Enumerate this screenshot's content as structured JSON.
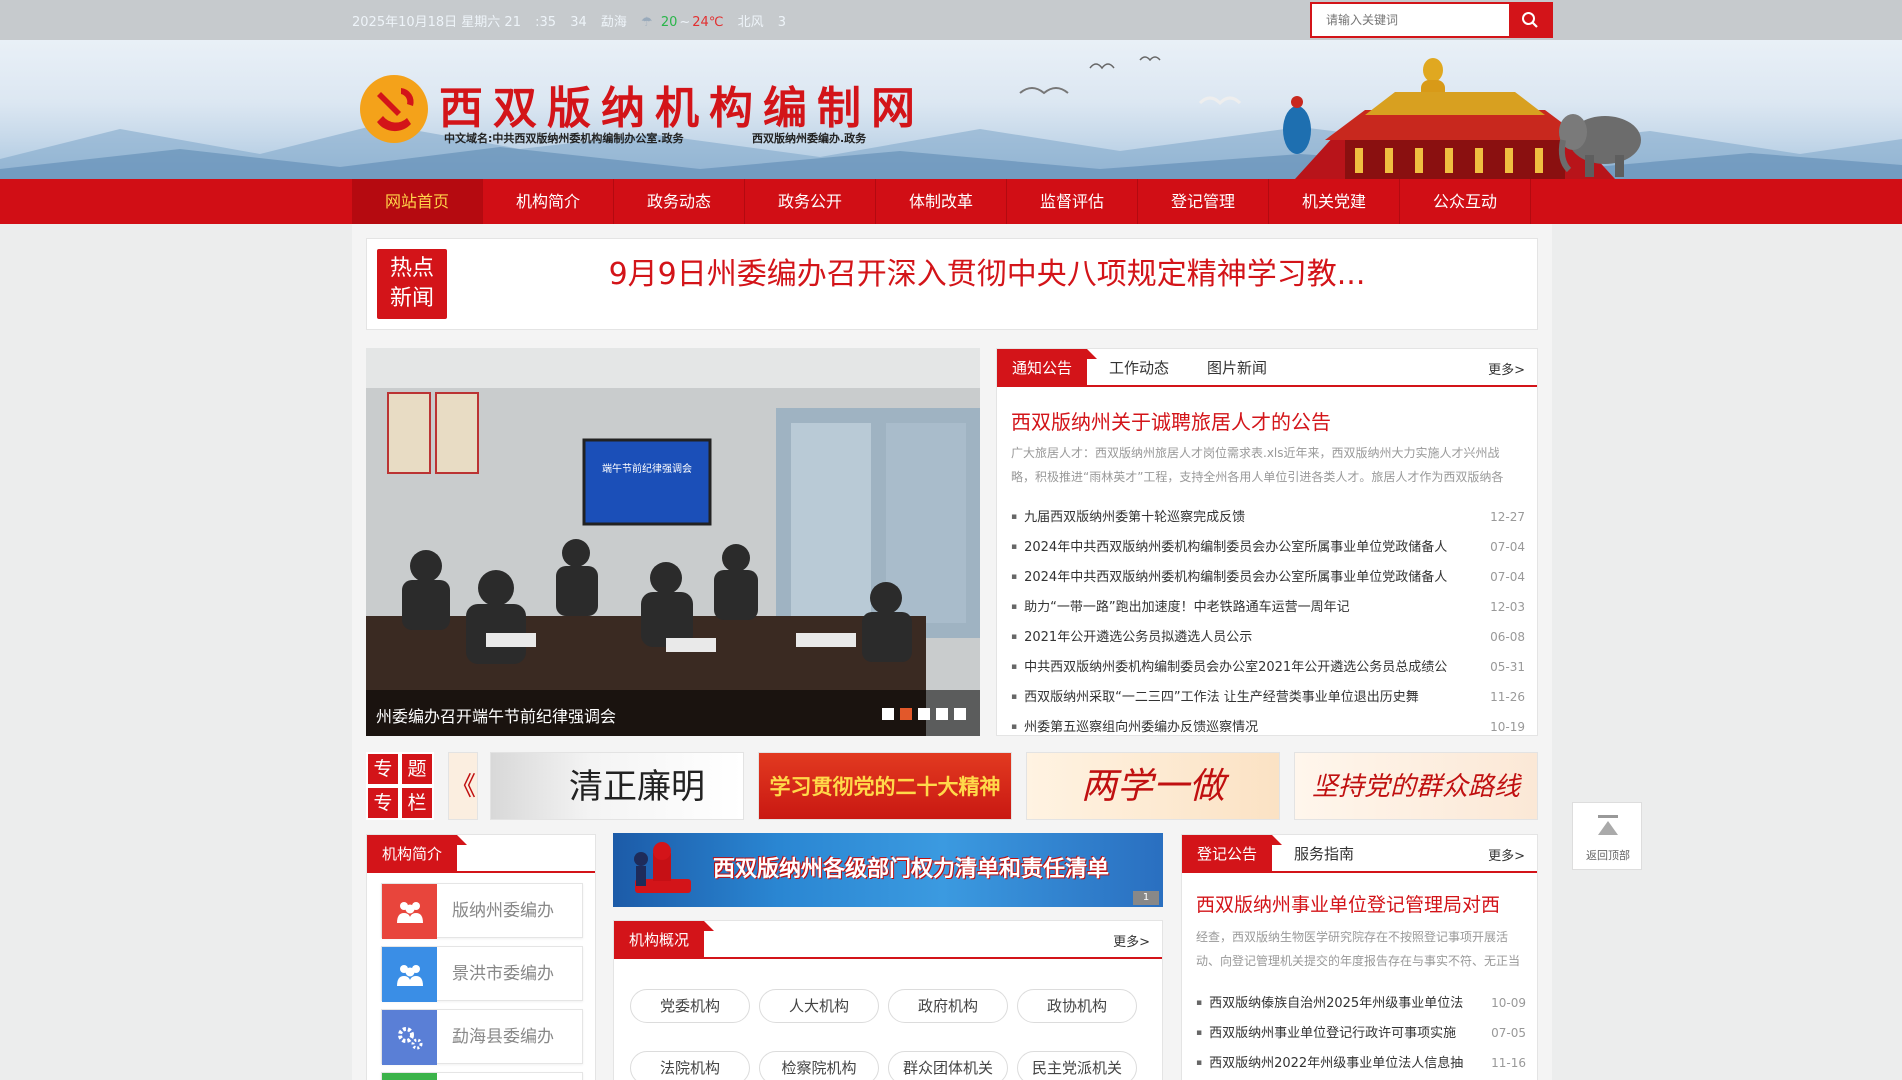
{
  "topbar": {
    "date": "2025年10月18日 星期六 21",
    "aqi": ":35",
    "aqi2": "34",
    "city": "勐海",
    "temp_low": "20",
    "temp_high": "24℃",
    "wind": "北风",
    "wind_level": "3"
  },
  "search": {
    "placeholder": "请输入关键词"
  },
  "header": {
    "title": "西双版纳机构编制网",
    "sub1": "中文域名:中共西双版纳州委机构编制办公室.政务",
    "sub2": "西双版纳州委编办.政务"
  },
  "nav": [
    {
      "label": "网站首页",
      "active": true
    },
    {
      "label": "机构简介"
    },
    {
      "label": "政务动态"
    },
    {
      "label": "政务公开"
    },
    {
      "label": "体制改革"
    },
    {
      "label": "监督评估"
    },
    {
      "label": "登记管理"
    },
    {
      "label": "机关党建"
    },
    {
      "label": "公众互动"
    }
  ],
  "hot": {
    "badge_line1": "热点",
    "badge_line2": "新闻",
    "title": "9月9日州委编办召开深入贯彻中央八项规定精神学习教..."
  },
  "slider": {
    "caption": "州委编办召开端午节前纪律强调会",
    "screen_text": "端午节前纪律强调会",
    "dots": 5,
    "active_dot": 2
  },
  "notice": {
    "tabs": [
      "通知公告",
      "工作动态",
      "图片新闻"
    ],
    "more": "更多>",
    "lead_title": "西双版纳州关于诚聘旅居人才的公告",
    "lead_desc": "广大旅居人才：西双版纳州旅居人才岗位需求表.xls近年来，西双版纳州大力实施人才兴州战略，积极推进“雨林英才”工程，支持全州各用人单位引进各类人才。旅居人才作为西双版纳各",
    "items": [
      {
        "title": "九届西双版纳州委第十轮巡察完成反馈",
        "date": "12-27"
      },
      {
        "title": "2024年中共西双版纳州委机构编制委员会办公室所属事业单位党政储备人",
        "date": "07-04"
      },
      {
        "title": "2024年中共西双版纳州委机构编制委员会办公室所属事业单位党政储备人",
        "date": "07-04"
      },
      {
        "title": "助力“一带一路”跑出加速度！中老铁路通车运营一周年记",
        "date": "12-03"
      },
      {
        "title": "2021年公开遴选公务员拟遴选人员公示",
        "date": "06-08"
      },
      {
        "title": "中共西双版纳州委机构编制委员会办公室2021年公开遴选公务员总成绩公",
        "date": "05-31"
      },
      {
        "title": "西双版纳州采取“一二三四”工作法 让生产经营类事业单位退出历史舞",
        "date": "11-26"
      },
      {
        "title": "州委第五巡察组向州委编办反馈巡察情况",
        "date": "10-19"
      }
    ]
  },
  "topics": {
    "label": [
      "专",
      "题",
      "专",
      "栏"
    ],
    "banners": [
      {
        "text": "清正廉明"
      },
      {
        "text": "学习贯彻党的二十大精神"
      },
      {
        "text": "两学一做"
      },
      {
        "text": "坚持党的群众路线"
      }
    ]
  },
  "org_intro": {
    "tab": "机构简介",
    "items": [
      {
        "name": "版纳州委编办",
        "color": "#e8453c"
      },
      {
        "name": "景洪市委编办",
        "color": "#3a8ee6"
      },
      {
        "name": "勐海县委编办",
        "color": "#5a7fd6"
      },
      {
        "name": "",
        "color": "#3bb34a"
      }
    ]
  },
  "power_banner": {
    "text": "西双版纳州各级部门权力清单和责任清单",
    "num": "1"
  },
  "org_overview": {
    "tab": "机构概况",
    "more": "更多>",
    "pills": [
      "党委机构",
      "人大机构",
      "政府机构",
      "政协机构",
      "法院机构",
      "检察院机构",
      "群众团体机关",
      "民主党派机关"
    ]
  },
  "register": {
    "tabs": [
      "登记公告",
      "服务指南"
    ],
    "more": "更多>",
    "lead_title": "西双版纳州事业单位登记管理局对西",
    "lead_desc": "经查，西双版纳生物医学研究院存在不按照登记事项开展活动、向登记管理机关提交的年度报告存在与事实不符、无正当",
    "items": [
      {
        "title": "西双版纳傣族自治州2025年州级事业单位法",
        "date": "10-09"
      },
      {
        "title": "西双版纳州事业单位登记行政许可事项实施",
        "date": "07-05"
      },
      {
        "title": "西双版纳州2022年州级事业单位法人信息抽",
        "date": "11-16"
      }
    ]
  },
  "back_top": {
    "label": "返回顶部"
  },
  "colors": {
    "brand_red": "#d31419",
    "nav_red": "#d10e15",
    "active_gold": "#ffd34a",
    "dot_orange": "#e2582a"
  }
}
